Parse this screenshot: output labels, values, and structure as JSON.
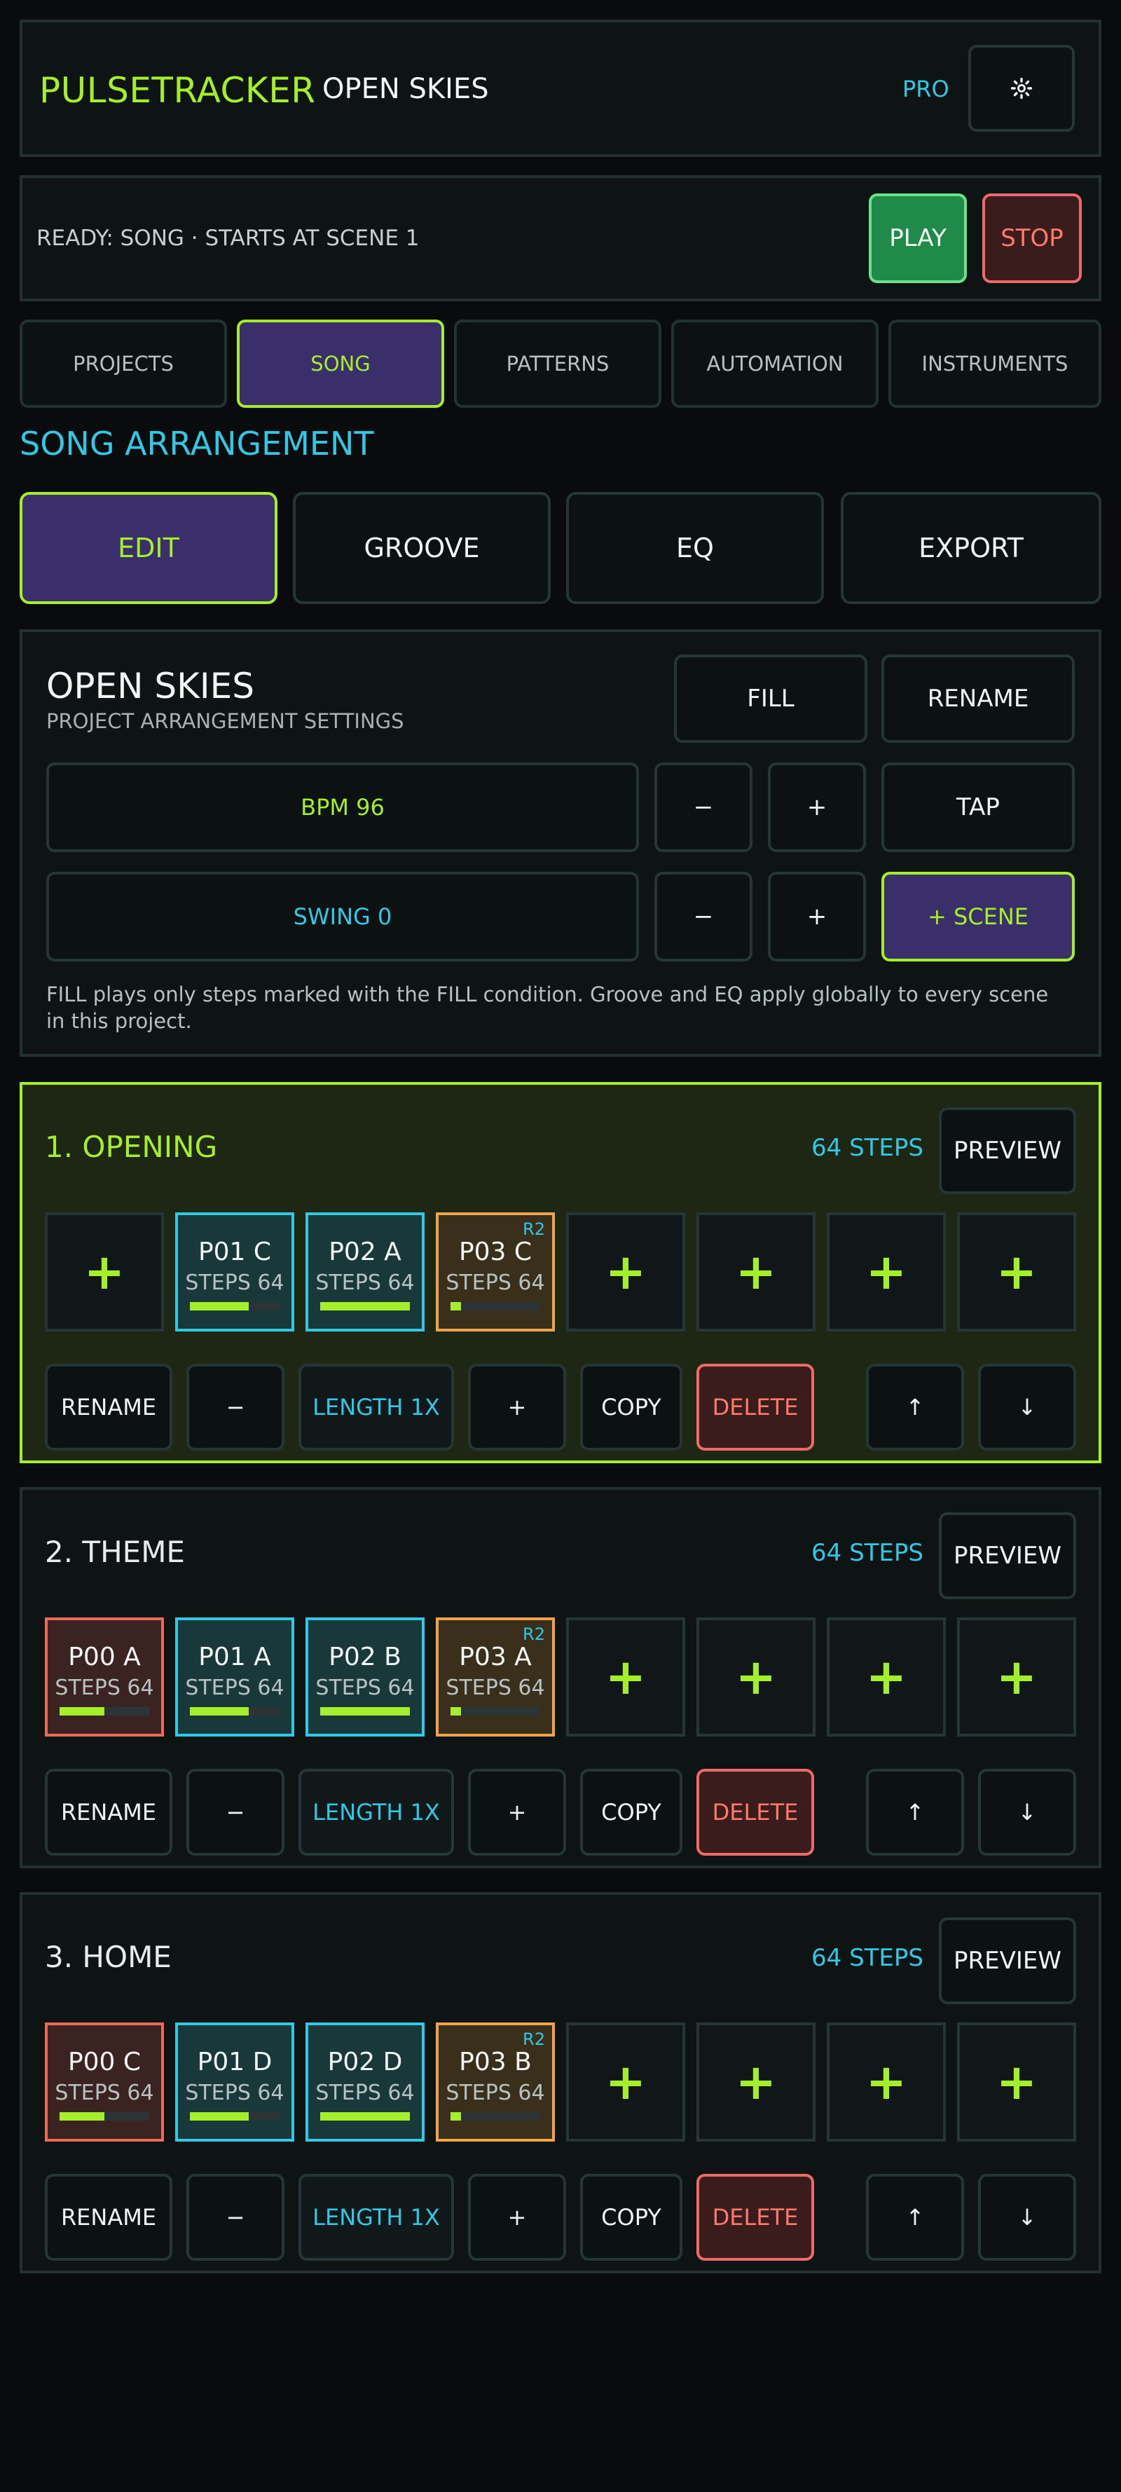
{
  "app": {
    "name": "PULSETRACKER",
    "project": "OPEN SKIES",
    "pro": "PRO",
    "settings_icon": "gear-icon"
  },
  "transport": {
    "status": "READY: SONG · STARTS AT SCENE 1",
    "play": "PLAY",
    "stop": "STOP"
  },
  "tabs": [
    "PROJECTS",
    "SONG",
    "PATTERNS",
    "AUTOMATION",
    "INSTRUMENTS"
  ],
  "active_tab": "SONG",
  "section_title": "SONG ARRANGEMENT",
  "modes": [
    "EDIT",
    "GROOVE",
    "EQ",
    "EXPORT"
  ],
  "active_mode": "EDIT",
  "settings": {
    "title": "OPEN SKIES",
    "subtitle": "PROJECT ARRANGEMENT SETTINGS",
    "fill": "FILL",
    "rename": "RENAME",
    "bpm": "BPM 96",
    "swing": "SWING 0",
    "minus": "−",
    "plus": "+",
    "tap": "TAP",
    "add_scene": "+ SCENE",
    "note": "FILL plays only steps marked with the FILL condition. Groove and EQ apply globally to every scene in this project."
  },
  "scene_controls": {
    "rename": "RENAME",
    "minus": "−",
    "length": "LENGTH 1X",
    "plus": "+",
    "copy": "COPY",
    "delete": "DELETE",
    "up": "↑",
    "down": "↓",
    "preview": "PREVIEW",
    "add": "+"
  },
  "scenes": [
    {
      "title": "1. OPENING",
      "steps": "64 STEPS",
      "slots": [
        {
          "empty": true
        },
        {
          "name": "P01 C",
          "steps": "STEPS 64",
          "color": "cyan",
          "progress": 0.66
        },
        {
          "name": "P02 A",
          "steps": "STEPS 64",
          "color": "cyan",
          "progress": 1.0
        },
        {
          "name": "P03 C",
          "steps": "STEPS 64",
          "color": "orange",
          "progress": 0.12,
          "badge": "R2"
        }
      ]
    },
    {
      "title": "2. THEME",
      "steps": "64 STEPS",
      "slots": [
        {
          "name": "P00 A",
          "steps": "STEPS 64",
          "color": "red",
          "progress": 0.5
        },
        {
          "name": "P01 A",
          "steps": "STEPS 64",
          "color": "cyan",
          "progress": 0.66
        },
        {
          "name": "P02 B",
          "steps": "STEPS 64",
          "color": "cyan",
          "progress": 1.0
        },
        {
          "name": "P03 A",
          "steps": "STEPS 64",
          "color": "orange",
          "progress": 0.12,
          "badge": "R2"
        }
      ]
    },
    {
      "title": "3. HOME",
      "steps": "64 STEPS",
      "slots": [
        {
          "name": "P00 C",
          "steps": "STEPS 64",
          "color": "red",
          "progress": 0.5
        },
        {
          "name": "P01 D",
          "steps": "STEPS 64",
          "color": "cyan",
          "progress": 0.66
        },
        {
          "name": "P02 D",
          "steps": "STEPS 64",
          "color": "cyan",
          "progress": 1.0
        },
        {
          "name": "P03 B",
          "steps": "STEPS 64",
          "color": "orange",
          "progress": 0.12,
          "badge": "R2"
        }
      ]
    }
  ],
  "colors": {
    "accent": "#a5ee2a",
    "cyan": "#32c8e4",
    "play": "#1f8a4a",
    "stop": "#ff7a6a",
    "active_bg": "#3a2f6b"
  }
}
